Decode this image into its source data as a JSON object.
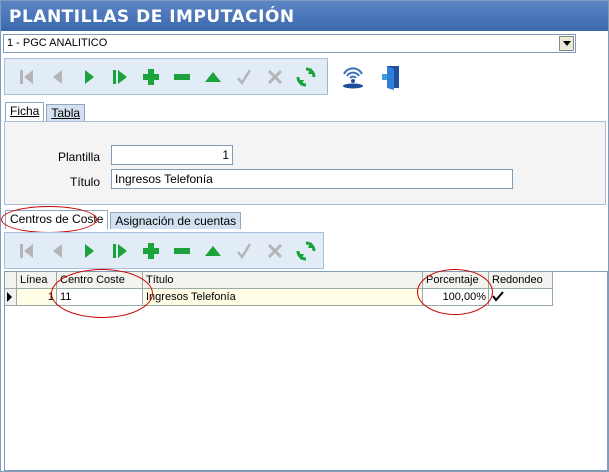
{
  "window": {
    "title": "PLANTILLAS DE IMPUTACIÓN"
  },
  "selector": {
    "value": "1 - PGC ANALITICO"
  },
  "main_toolbar": {
    "buttons": [
      "first-icon",
      "prev-icon",
      "next-icon",
      "last-icon",
      "add-icon",
      "delete-icon",
      "edit-icon",
      "confirm-icon",
      "cancel-icon",
      "refresh-icon",
      "signal-icon",
      "exit-door-icon"
    ]
  },
  "top_tabs": [
    {
      "label": "Ficha",
      "active": true
    },
    {
      "label": "Tabla",
      "active": false
    }
  ],
  "form": {
    "plantilla_label": "Plantilla",
    "plantilla_value": "1",
    "titulo_label": "Título",
    "titulo_value": "Ingresos Telefonía"
  },
  "bottom_tabs": [
    {
      "label": "Centros de Coste",
      "active": true
    },
    {
      "label": "Asignación de cuentas",
      "active": false
    }
  ],
  "grid": {
    "columns": [
      "Línea",
      "Centro Coste",
      "Título",
      "Porcentaje",
      "Redondeo"
    ],
    "rows": [
      {
        "linea": "1",
        "centro_coste": "11",
        "titulo": "Ingresos Telefonía",
        "porcentaje": "100,00%",
        "redondeo": true
      }
    ]
  },
  "colors": {
    "title_bar": "#3b67ad",
    "toolbar_bg": "#e1ecf7",
    "green": "#1aa33a",
    "grey_icon": "#b5b5b5",
    "annotation": "#cc0000",
    "row_highlight": "#fffde5"
  }
}
